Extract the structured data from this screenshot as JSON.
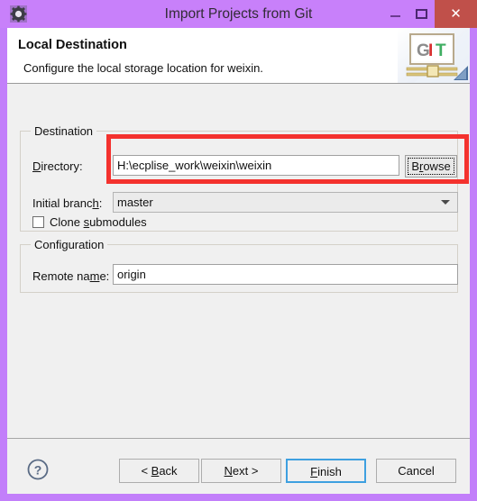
{
  "window": {
    "title": "Import Projects from Git",
    "icon": "gear-icon",
    "minimize_label": "–",
    "maximize_label": "□",
    "close_label": "✕",
    "frame_color": "#c880fa",
    "close_button_color": "#c0504a"
  },
  "header": {
    "title": "Local Destination",
    "description": "Configure the local storage location for weixin.",
    "logo": {
      "name": "git-logo",
      "letters": [
        "G",
        "I",
        "T"
      ],
      "letter_colors": [
        "#8c8c8c",
        "#d83030",
        "#3fae62"
      ]
    }
  },
  "destination": {
    "group_title": "Destination",
    "directory": {
      "label": "Directory:",
      "label_mnemonic": "D",
      "value": "H:\\ecplise_work\\weixin\\weixin"
    },
    "browse_button": "Browse",
    "browse_mnemonic": "w",
    "initial_branch": {
      "label": "Initial branch:",
      "label_mnemonic": "h",
      "value": "master",
      "options": [
        "master"
      ]
    },
    "clone_submodules": {
      "label": "Clone submodules",
      "mnemonic": "s",
      "checked": false
    }
  },
  "configuration": {
    "group_title": "Configuration",
    "remote_name": {
      "label": "Remote name:",
      "label_mnemonic": "m",
      "value": "origin"
    }
  },
  "annotation": {
    "shape": "rectangle",
    "color": "#f4322e",
    "target": "directory-field-row"
  },
  "footer": {
    "help_icon": "help-circle-icon",
    "buttons": [
      {
        "label": "< Back",
        "mnemonic": "B",
        "default": false,
        "enabled": true
      },
      {
        "label": "Next >",
        "mnemonic": "N",
        "default": false,
        "enabled": true
      },
      {
        "label": "Finish",
        "mnemonic": "F",
        "default": true,
        "enabled": true
      },
      {
        "label": "Cancel",
        "mnemonic": "",
        "default": false,
        "enabled": true
      }
    ]
  }
}
